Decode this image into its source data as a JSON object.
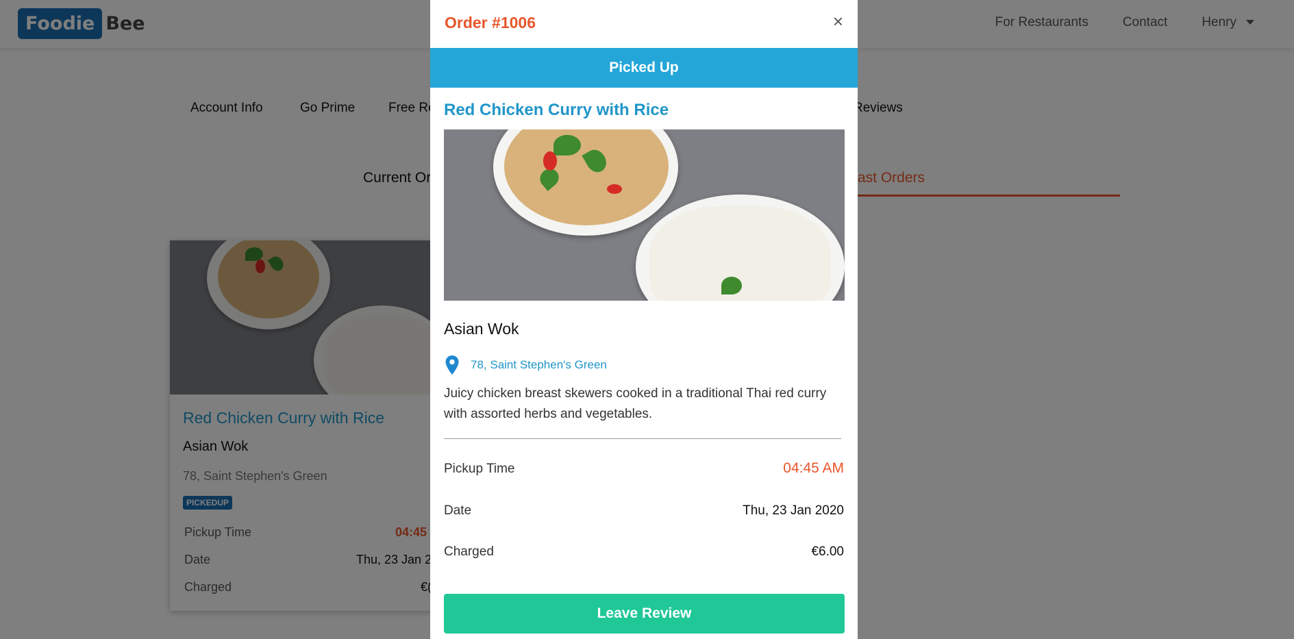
{
  "brand": {
    "part1": "Foodie",
    "part2": "Bee"
  },
  "navbar": {
    "links": [
      "For Restaurants",
      "Contact"
    ],
    "user": "Henry"
  },
  "account_tabs": [
    "Account Info",
    "Go Prime",
    "Free Re",
    "Reviews"
  ],
  "order_tabs": {
    "current": "Current Or",
    "past": "ast Orders"
  },
  "card": {
    "title": "Red Chicken Curry with Rice",
    "restaurant": "Asian Wok",
    "address": "78, Saint Stephen's Green",
    "status_badge": "PICKEDUP",
    "rows": [
      {
        "label": "Pickup Time",
        "value": "04:45"
      },
      {
        "label": "Date",
        "value": "Thu, 23 Jan 2"
      },
      {
        "label": "Charged",
        "value": "€("
      }
    ]
  },
  "modal": {
    "title": "Order #1006",
    "close": "×",
    "status": "Picked Up",
    "dish": "Red Chicken Curry with Rice",
    "restaurant": "Asian Wok",
    "address": "78, Saint Stephen's Green",
    "description": "Juicy chicken breast skewers cooked in a traditional Thai red curry with assorted herbs and vegetables.",
    "rows": [
      {
        "label": "Pickup Time",
        "value": "04:45 AM"
      },
      {
        "label": "Date",
        "value": "Thu, 23 Jan 2020"
      },
      {
        "label": "Charged",
        "value": "€6.00"
      }
    ],
    "review_button": "Leave Review"
  },
  "colors": {
    "accent": "#e8562a",
    "blue": "#24a6d8",
    "green": "#20c897",
    "brand": "#1b6fb3"
  },
  "icons": {
    "close": "close-icon",
    "location": "location-pin-icon",
    "dropdown": "chevron-down-icon"
  }
}
